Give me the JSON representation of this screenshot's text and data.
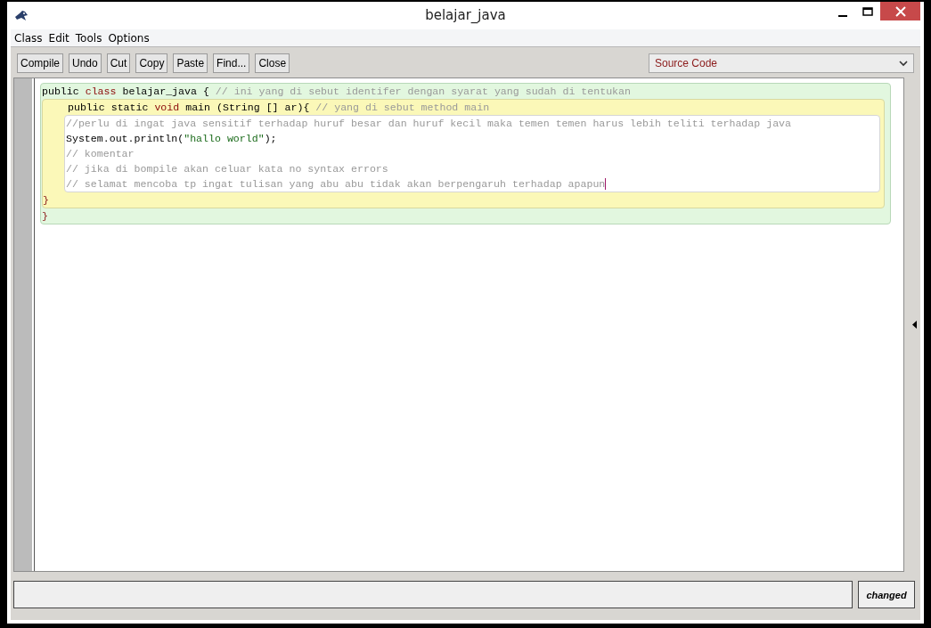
{
  "window": {
    "title": "belajar_java"
  },
  "menu": [
    "Class",
    "Edit",
    "Tools",
    "Options"
  ],
  "toolbar": [
    "Compile",
    "Undo",
    "Cut",
    "Copy",
    "Paste",
    "Find...",
    "Close"
  ],
  "view_select": {
    "value": "Source Code"
  },
  "editor": {
    "scope": {
      "kind": "class",
      "header": [
        {
          "kind": "plain",
          "text": "public "
        },
        {
          "kind": "keyword",
          "text": "class"
        },
        {
          "kind": "plain",
          "text": " belajar_java { "
        },
        {
          "kind": "comment",
          "text": "// ini yang di sebut identifer dengan syarat yang sudah di tentukan"
        }
      ],
      "children": [
        {
          "kind": "method",
          "header": [
            {
              "kind": "plain",
              "text": "public static "
            },
            {
              "kind": "keyword",
              "text": "void"
            },
            {
              "kind": "plain",
              "text": " main (String [] ar){ "
            },
            {
              "kind": "comment",
              "text": "// yang di sebut method main"
            }
          ],
          "children": [
            {
              "kind": "block",
              "lines": [
                {
                  "cursor": false,
                  "tokens": [
                    {
                      "kind": "comment",
                      "text": "//perlu di ingat java sensitif terhadap huruf besar dan huruf kecil maka temen temen harus lebih teliti terhadap java"
                    }
                  ]
                },
                {
                  "cursor": false,
                  "tokens": [
                    {
                      "kind": "plain",
                      "text": "System.out.println("
                    },
                    {
                      "kind": "string",
                      "text": "\"hallo world\""
                    },
                    {
                      "kind": "plain",
                      "text": ");"
                    }
                  ]
                },
                {
                  "cursor": false,
                  "tokens": [
                    {
                      "kind": "comment",
                      "text": "// komentar"
                    }
                  ]
                },
                {
                  "cursor": false,
                  "tokens": [
                    {
                      "kind": "comment",
                      "text": "// jika di bompile akan celuar kata no syntax errors"
                    }
                  ]
                },
                {
                  "cursor": true,
                  "tokens": [
                    {
                      "kind": "comment",
                      "text": "// selamat mencoba tp ingat tulisan yang abu abu tidak akan berpengaruh terhadap apapun"
                    }
                  ]
                }
              ]
            }
          ],
          "footer": "}"
        }
      ],
      "footer": "}"
    }
  },
  "status_bar": {
    "state": "changed"
  }
}
